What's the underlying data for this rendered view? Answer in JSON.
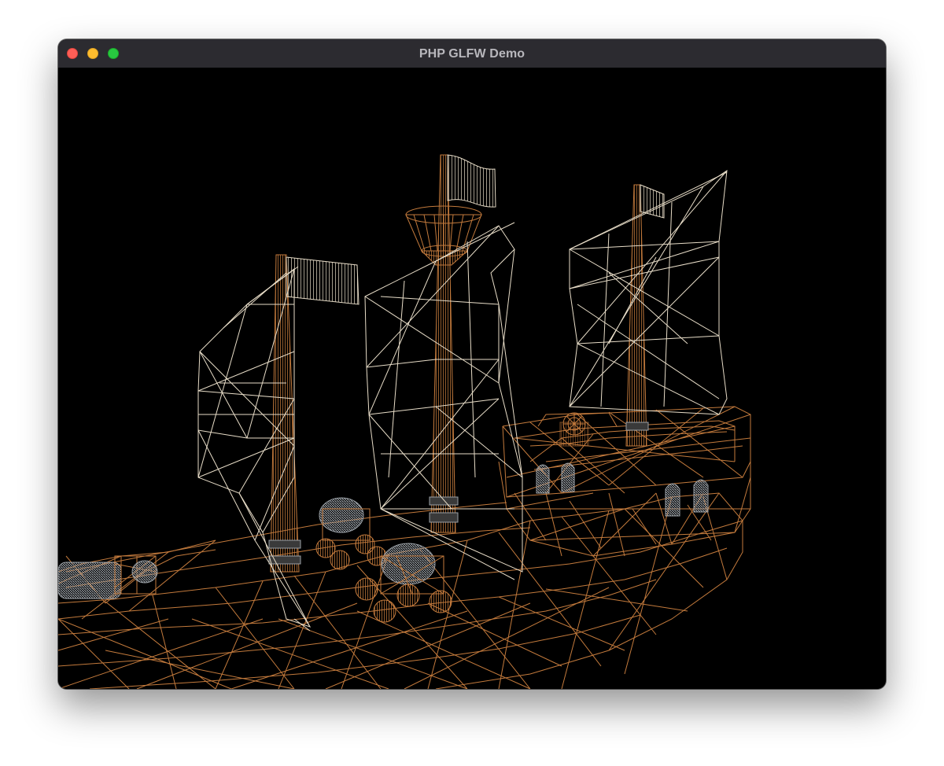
{
  "window": {
    "title": "PHP GLFW Demo",
    "controls": [
      "close",
      "minimize",
      "zoom"
    ]
  },
  "scene": {
    "description_icon": "wireframe-ship-icon",
    "colors": {
      "hull": "#c37a3c",
      "sail": "#e8ddc8",
      "metal": "#9aa0a6",
      "background": "#000000"
    }
  }
}
